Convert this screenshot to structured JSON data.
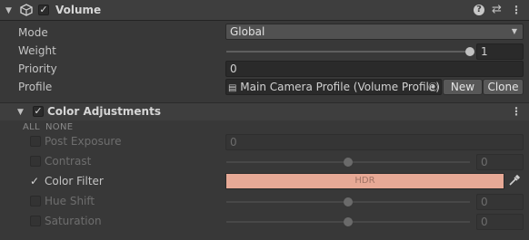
{
  "header": {
    "title": "Volume",
    "enabled": true
  },
  "volume": {
    "mode": {
      "label": "Mode",
      "value": "Global"
    },
    "weight": {
      "label": "Weight",
      "value": "1",
      "fraction": 1.0
    },
    "priority": {
      "label": "Priority",
      "value": "0"
    },
    "profile": {
      "label": "Profile",
      "value": "Main Camera Profile (Volume Profile)",
      "new_label": "New",
      "clone_label": "Clone"
    }
  },
  "color_adjustments": {
    "title": "Color Adjustments",
    "all_label": "ALL",
    "none_label": "NONE",
    "post_exposure": {
      "label": "Post Exposure",
      "value": "0",
      "checked": false
    },
    "contrast": {
      "label": "Contrast",
      "value": "0",
      "checked": false,
      "fraction": 0.5
    },
    "color_filter": {
      "label": "Color Filter",
      "swatch_text": "HDR",
      "color": "#e7a996",
      "checked": true
    },
    "hue_shift": {
      "label": "Hue Shift",
      "value": "0",
      "checked": false,
      "fraction": 0.5
    },
    "saturation": {
      "label": "Saturation",
      "value": "0",
      "checked": false,
      "fraction": 0.5
    }
  }
}
